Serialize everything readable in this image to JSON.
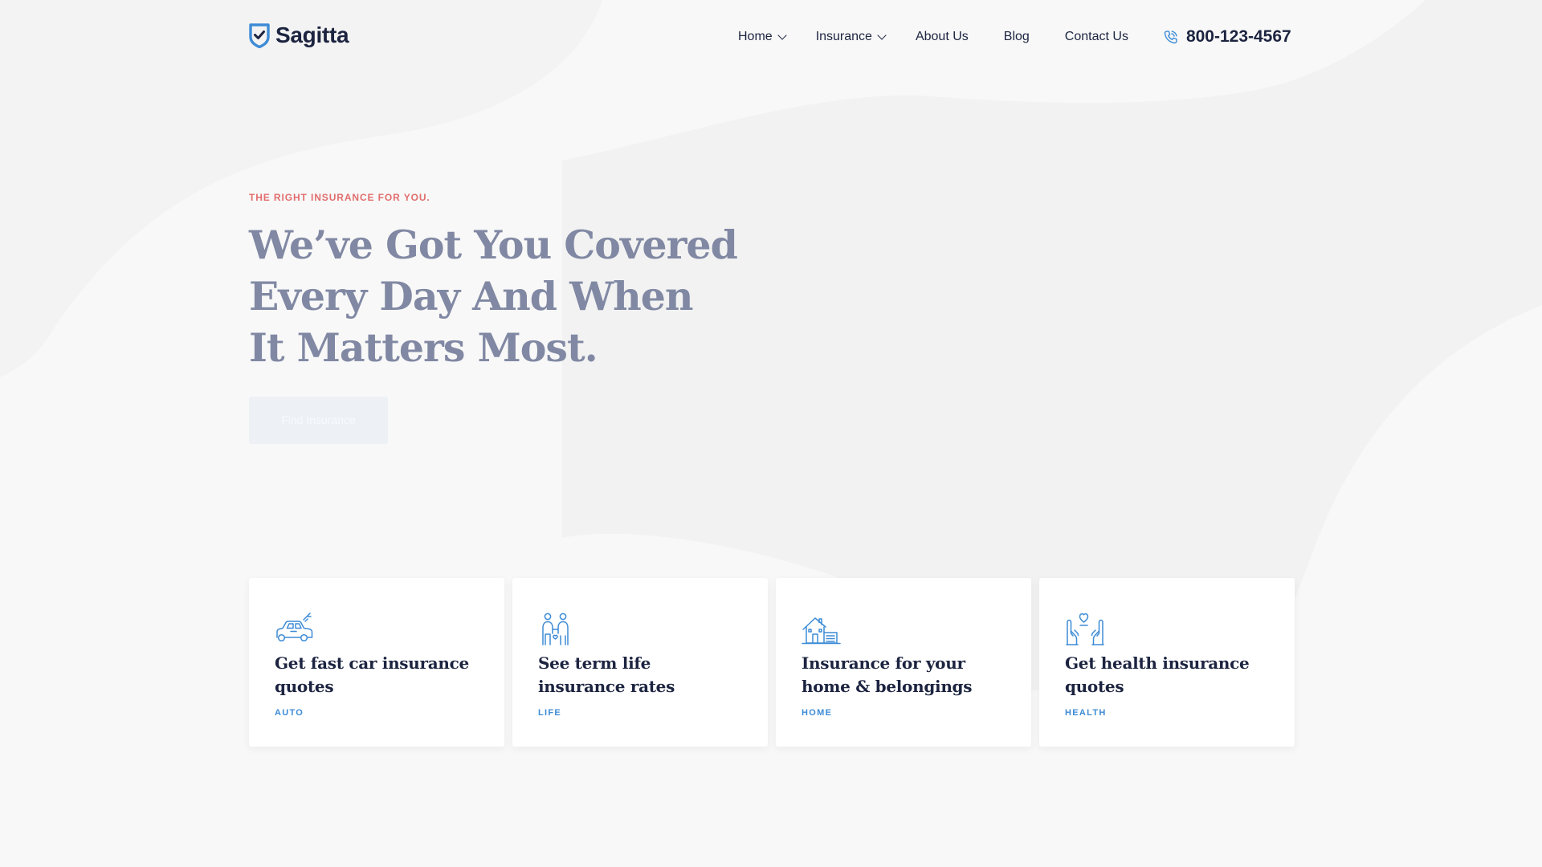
{
  "brand": {
    "name": "Sagitta",
    "logo_icon": "shield-check-icon",
    "accent": "#3d8bd6",
    "navy": "#1c2440",
    "coral": "#e26d6d"
  },
  "nav": {
    "items": [
      {
        "label": "Home",
        "has_dropdown": true
      },
      {
        "label": "Insurance",
        "has_dropdown": true
      },
      {
        "label": "About Us",
        "has_dropdown": false
      },
      {
        "label": "Blog",
        "has_dropdown": false
      },
      {
        "label": "Contact Us",
        "has_dropdown": false
      }
    ],
    "phone": "800-123-4567",
    "phone_icon": "phone-icon"
  },
  "hero": {
    "eyebrow": "THE RIGHT INSURANCE FOR YOU.",
    "headline_lines": [
      "We’ve Got You Covered",
      "Every Day And When",
      "It Matters Most."
    ],
    "cta_label": "Find Insurance"
  },
  "cards": [
    {
      "icon": "car-icon",
      "title": "Get fast car insurance quotes",
      "tag": "AUTO"
    },
    {
      "icon": "family-icon",
      "title": "See term life insurance rates",
      "tag": "LIFE"
    },
    {
      "icon": "house-icon",
      "title": "Insurance for your home & belongings",
      "tag": "HOME"
    },
    {
      "icon": "health-hands-heart-icon",
      "title": "Get health insurance quotes",
      "tag": "HEALTH"
    }
  ]
}
